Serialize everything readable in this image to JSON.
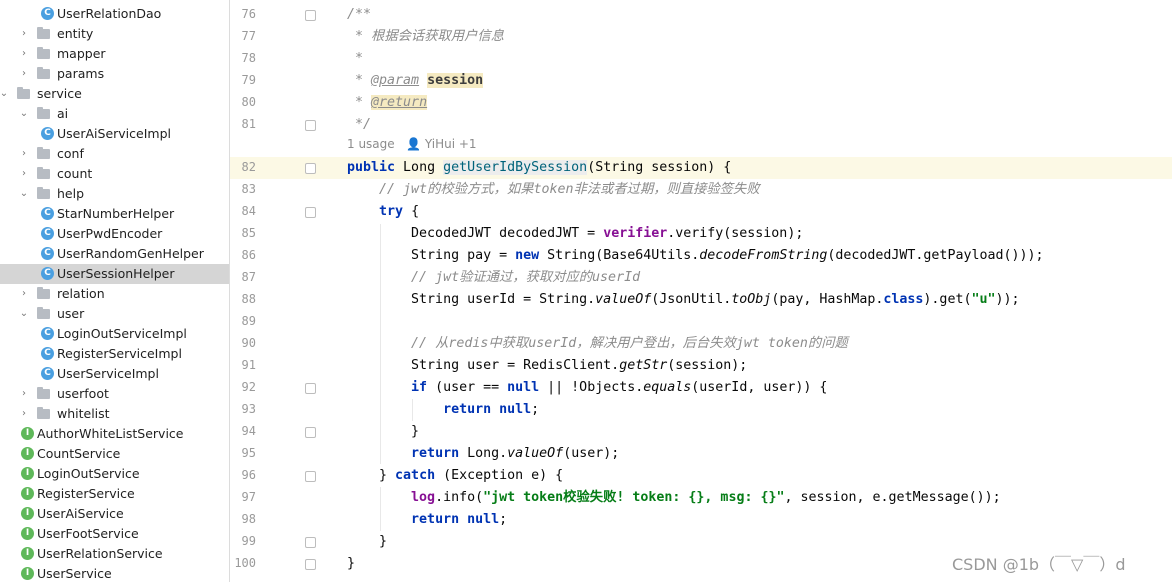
{
  "project_tree": {
    "items": [
      {
        "label": "UserRelationDao",
        "kind": "class",
        "indent": 2
      },
      {
        "label": "entity",
        "kind": "folder",
        "indent": 1,
        "collapsed": true
      },
      {
        "label": "mapper",
        "kind": "folder",
        "indent": 1,
        "collapsed": true
      },
      {
        "label": "params",
        "kind": "folder",
        "indent": 1,
        "collapsed": true
      },
      {
        "label": "service",
        "kind": "folder",
        "indent": 0,
        "collapsed": false
      },
      {
        "label": "ai",
        "kind": "folder",
        "indent": 1,
        "collapsed": false
      },
      {
        "label": "UserAiServiceImpl",
        "kind": "class",
        "indent": 2
      },
      {
        "label": "conf",
        "kind": "folder",
        "indent": 1,
        "collapsed": true
      },
      {
        "label": "count",
        "kind": "folder",
        "indent": 1,
        "collapsed": true
      },
      {
        "label": "help",
        "kind": "folder",
        "indent": 1,
        "collapsed": false
      },
      {
        "label": "StarNumberHelper",
        "kind": "class",
        "indent": 2
      },
      {
        "label": "UserPwdEncoder",
        "kind": "class",
        "indent": 2
      },
      {
        "label": "UserRandomGenHelper",
        "kind": "class",
        "indent": 2
      },
      {
        "label": "UserSessionHelper",
        "kind": "class",
        "indent": 2,
        "selected": true
      },
      {
        "label": "relation",
        "kind": "folder",
        "indent": 1,
        "collapsed": true
      },
      {
        "label": "user",
        "kind": "folder",
        "indent": 1,
        "collapsed": false
      },
      {
        "label": "LoginOutServiceImpl",
        "kind": "class",
        "indent": 2
      },
      {
        "label": "RegisterServiceImpl",
        "kind": "class",
        "indent": 2
      },
      {
        "label": "UserServiceImpl",
        "kind": "class",
        "indent": 2
      },
      {
        "label": "userfoot",
        "kind": "folder",
        "indent": 1,
        "collapsed": true
      },
      {
        "label": "whitelist",
        "kind": "folder",
        "indent": 1,
        "collapsed": true
      },
      {
        "label": "AuthorWhiteListService",
        "kind": "interface",
        "indent": 1
      },
      {
        "label": "CountService",
        "kind": "interface",
        "indent": 1
      },
      {
        "label": "LoginOutService",
        "kind": "interface",
        "indent": 1
      },
      {
        "label": "RegisterService",
        "kind": "interface",
        "indent": 1
      },
      {
        "label": "UserAiService",
        "kind": "interface",
        "indent": 1
      },
      {
        "label": "UserFootService",
        "kind": "interface",
        "indent": 1
      },
      {
        "label": "UserRelationService",
        "kind": "interface",
        "indent": 1
      },
      {
        "label": "UserService",
        "kind": "interface",
        "indent": 1
      }
    ]
  },
  "editor": {
    "inlay_hint": "1 usage   👤 YiHui +1",
    "highlighted_line": "82",
    "lines": [
      {
        "n": "76",
        "html": "<span class='cm'>/**</span>"
      },
      {
        "n": "77",
        "html": "<span class='cm'> * 根据会话获取用户信息</span>"
      },
      {
        "n": "78",
        "html": "<span class='cm'> *</span>"
      },
      {
        "n": "79",
        "html": "<span class='cm'> * </span><span class='tag'>@param</span><span class='cm'> </span><span class='pname'>session</span>"
      },
      {
        "n": "80",
        "html": "<span class='cm'> * </span><span class='tag' style='background:#f5eac1'>@return</span>"
      },
      {
        "n": "81",
        "html": "<span class='cm'> */</span>"
      },
      {
        "n": "82",
        "html": "<span class='kw'>public</span> Long <span class='fn' style='background:#ededed'>getUserIdBySession</span>(String session) {"
      },
      {
        "n": "83",
        "html": "    <span class='cm'>// jwt的校验方式，如果token非法或者过期，则直接验签失败</span>"
      },
      {
        "n": "84",
        "html": "    <span class='kw'>try</span> {"
      },
      {
        "n": "85",
        "html": "        DecodedJWT decodedJWT = <span class='fld'>verifier</span>.verify(session);"
      },
      {
        "n": "86",
        "html": "        String pay = <span class='kw'>new</span> String(Base64Utils.<span class='st'>decodeFromString</span>(decodedJWT.getPayload()));"
      },
      {
        "n": "87",
        "html": "        <span class='cm'>// jwt验证通过，获取对应的userId</span>"
      },
      {
        "n": "88",
        "html": "        String userId = String.<span class='st'>valueOf</span>(JsonUtil.<span class='st'>toObj</span>(pay, HashMap.<span class='kw'>class</span>).get(<span class='str'>\"u\"</span>));"
      },
      {
        "n": "89",
        "html": ""
      },
      {
        "n": "90",
        "html": "        <span class='cm'>// 从redis中获取userId，解决用户登出，后台失效jwt token的问题</span>"
      },
      {
        "n": "91",
        "html": "        String user = RedisClient.<span class='st'>getStr</span>(session);"
      },
      {
        "n": "92",
        "html": "        <span class='kw'>if</span> (user == <span class='kw'>null</span> || !Objects.<span class='st'>equals</span>(userId, user)) {"
      },
      {
        "n": "93",
        "html": "            <span class='kw'>return null</span>;"
      },
      {
        "n": "94",
        "html": "        }"
      },
      {
        "n": "95",
        "html": "        <span class='kw'>return</span> Long.<span class='st'>valueOf</span>(user);"
      },
      {
        "n": "96",
        "html": "    } <span class='kw'>catch</span> (Exception e) {"
      },
      {
        "n": "97",
        "html": "        <span class='fld'>log</span>.info(<span class='str'>\"jwt token校验失败! token: {}, msg: {}\"</span>, session, e.getMessage());"
      },
      {
        "n": "98",
        "html": "        <span class='kw'>return null</span>;"
      },
      {
        "n": "99",
        "html": "    }"
      },
      {
        "n": "100",
        "html": "}"
      }
    ]
  },
  "watermark": "CSDN @1b（￣▽￣）d"
}
